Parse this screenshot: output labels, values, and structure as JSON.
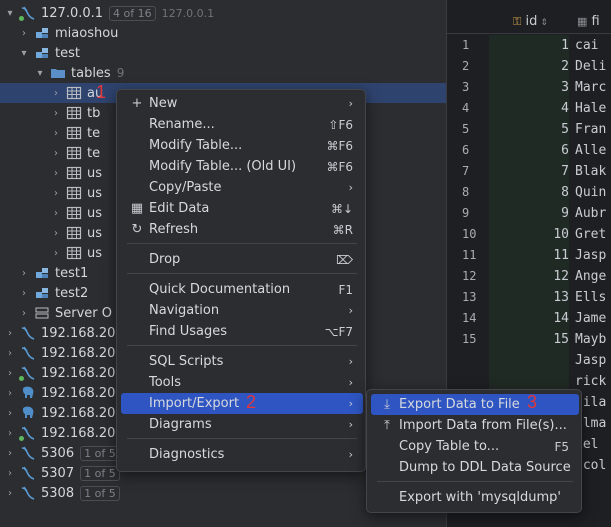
{
  "tree": {
    "root": {
      "label": "127.0.0.1",
      "badge": "4 of 16",
      "hint": "127.0.0.1"
    },
    "schemas": [
      "miaoshou",
      "test"
    ],
    "folder": {
      "label": "tables",
      "count": "9"
    },
    "tables": [
      "au",
      "tb",
      "te",
      "te",
      "us",
      "us",
      "us",
      "us",
      "us"
    ],
    "after": [
      {
        "label": "test1",
        "kind": "schema"
      },
      {
        "label": "test2",
        "kind": "schema"
      },
      {
        "label": "Server O",
        "kind": "server"
      }
    ],
    "connections": [
      {
        "label": "192.168.20",
        "kind": "db",
        "badge": ""
      },
      {
        "label": "192.168.20",
        "kind": "db",
        "badge": ""
      },
      {
        "label": "192.168.20",
        "kind": "db",
        "badge": ""
      },
      {
        "label": "192.168.20",
        "kind": "elephant",
        "badge": ""
      },
      {
        "label": "192.168.20",
        "kind": "elephant",
        "badge": ""
      },
      {
        "label": "192.168.20",
        "kind": "db",
        "badge": ""
      },
      {
        "label": "5306",
        "kind": "db",
        "badge": "1 of 5"
      },
      {
        "label": "5307",
        "kind": "db",
        "badge": "1 of 5"
      },
      {
        "label": "5308",
        "kind": "db",
        "badge": "1 of 5"
      }
    ]
  },
  "grid": {
    "col_id": "id",
    "col_name": "fi",
    "rows": [
      {
        "n": "1",
        "id": "1",
        "name": "cai"
      },
      {
        "n": "2",
        "id": "2",
        "name": "Deli"
      },
      {
        "n": "3",
        "id": "3",
        "name": "Marc"
      },
      {
        "n": "4",
        "id": "4",
        "name": "Hale"
      },
      {
        "n": "5",
        "id": "5",
        "name": "Fran"
      },
      {
        "n": "6",
        "id": "6",
        "name": "Alle"
      },
      {
        "n": "7",
        "id": "7",
        "name": "Blak"
      },
      {
        "n": "8",
        "id": "8",
        "name": "Quin"
      },
      {
        "n": "9",
        "id": "9",
        "name": "Aubr"
      },
      {
        "n": "10",
        "id": "10",
        "name": "Gret"
      },
      {
        "n": "11",
        "id": "11",
        "name": "Jasp"
      },
      {
        "n": "12",
        "id": "12",
        "name": "Ange"
      },
      {
        "n": "13",
        "id": "13",
        "name": "Ells"
      },
      {
        "n": "14",
        "id": "14",
        "name": "Jame"
      },
      {
        "n": "15",
        "id": "15",
        "name": "Mayb"
      },
      {
        "n": "",
        "id": "",
        "name": "Jasp"
      },
      {
        "n": "",
        "id": "",
        "name": "rick"
      },
      {
        "n": "",
        "id": "",
        "name": "aila"
      },
      {
        "n": "",
        "id": "",
        "name": "ilma"
      },
      {
        "n": "",
        "id": "",
        "name": "xel"
      },
      {
        "n": "",
        "id": "",
        "name": "icol"
      }
    ]
  },
  "menu": {
    "items": [
      {
        "label": "New",
        "icon": "+",
        "key": "",
        "sub": true
      },
      {
        "label": "Rename...",
        "icon": "",
        "key": "⇧F6",
        "sub": false
      },
      {
        "label": "Modify Table...",
        "icon": "",
        "key": "⌘F6",
        "sub": false
      },
      {
        "label": "Modify Table... (Old UI)",
        "icon": "",
        "key": "⌘F6",
        "sub": false
      },
      {
        "label": "Copy/Paste",
        "icon": "",
        "key": "",
        "sub": true
      },
      {
        "label": "Edit Data",
        "icon": "table-icon",
        "key": "⌘↓",
        "sub": false
      },
      {
        "label": "Refresh",
        "icon": "refresh-icon",
        "key": "⌘R",
        "sub": false
      },
      {
        "label": "Drop",
        "icon": "",
        "key": "⌦",
        "sub": false
      },
      {
        "label": "Quick Documentation",
        "icon": "",
        "key": "F1",
        "sub": false
      },
      {
        "label": "Navigation",
        "icon": "",
        "key": "",
        "sub": true
      },
      {
        "label": "Find Usages",
        "icon": "",
        "key": "⌥F7",
        "sub": false
      },
      {
        "label": "SQL Scripts",
        "icon": "",
        "key": "",
        "sub": true
      },
      {
        "label": "Tools",
        "icon": "",
        "key": "",
        "sub": true
      },
      {
        "label": "Import/Export",
        "icon": "",
        "key": "",
        "sub": true
      },
      {
        "label": "Diagrams",
        "icon": "",
        "key": "",
        "sub": true
      },
      {
        "label": "Diagnostics",
        "icon": "",
        "key": "",
        "sub": true
      }
    ]
  },
  "submenu": {
    "items": [
      {
        "label": "Export Data to File",
        "icon": "download-icon",
        "key": ""
      },
      {
        "label": "Import Data from File(s)...",
        "icon": "upload-icon",
        "key": ""
      },
      {
        "label": "Copy Table to...",
        "icon": "",
        "key": "F5"
      },
      {
        "label": "Dump to DDL Data Source",
        "icon": "",
        "key": ""
      },
      {
        "label": "Export with 'mysqldump'",
        "icon": "",
        "key": ""
      }
    ]
  },
  "steps": [
    "1",
    "2",
    "3"
  ],
  "colors": {
    "highlight": "#2e55c2",
    "selected_row": "#2e436e",
    "step_red": "#e0373b"
  }
}
